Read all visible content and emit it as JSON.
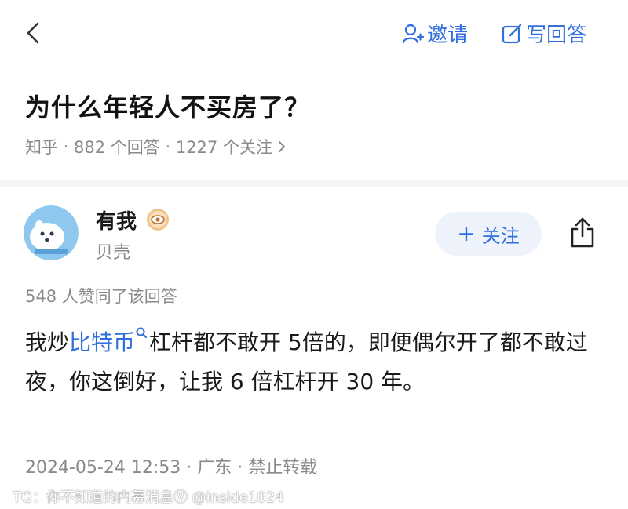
{
  "header": {
    "back_icon": "chevron-left-icon",
    "invite_label": "邀请",
    "invite_icon": "person-plus-icon",
    "write_answer_label": "写回答",
    "write_answer_icon": "edit-icon"
  },
  "question": {
    "title": "为什么年轻人不买房了？",
    "source": "知乎",
    "answers_count": "882 个回答",
    "followers_count": "1227 个关注",
    "separator": " · "
  },
  "author": {
    "name": "有我",
    "badge_icon": "eye-badge-icon",
    "subtitle": "贝壳",
    "follow_label": "关注",
    "follow_plus": "+",
    "share_icon": "share-icon"
  },
  "answer": {
    "votes": "548 人赞同了该回答",
    "text_before_link": "我炒",
    "link_text": "比特币",
    "text_after_link": "杠杆都不敢开 5倍的，即便偶尔开了都不敢过夜，你这倒好，让我 6 倍杠杆开 30 年。",
    "date": "2024-05-24 12:53",
    "location": "广东",
    "copyright": "禁止转载"
  },
  "watermark": "TG：你不知道的内幕消息Ⓥ @inside1024",
  "colors": {
    "accent": "#2f6fde",
    "text": "#1a1a1a",
    "muted": "#8a8a8a",
    "follow_bg": "#eef3fb"
  }
}
